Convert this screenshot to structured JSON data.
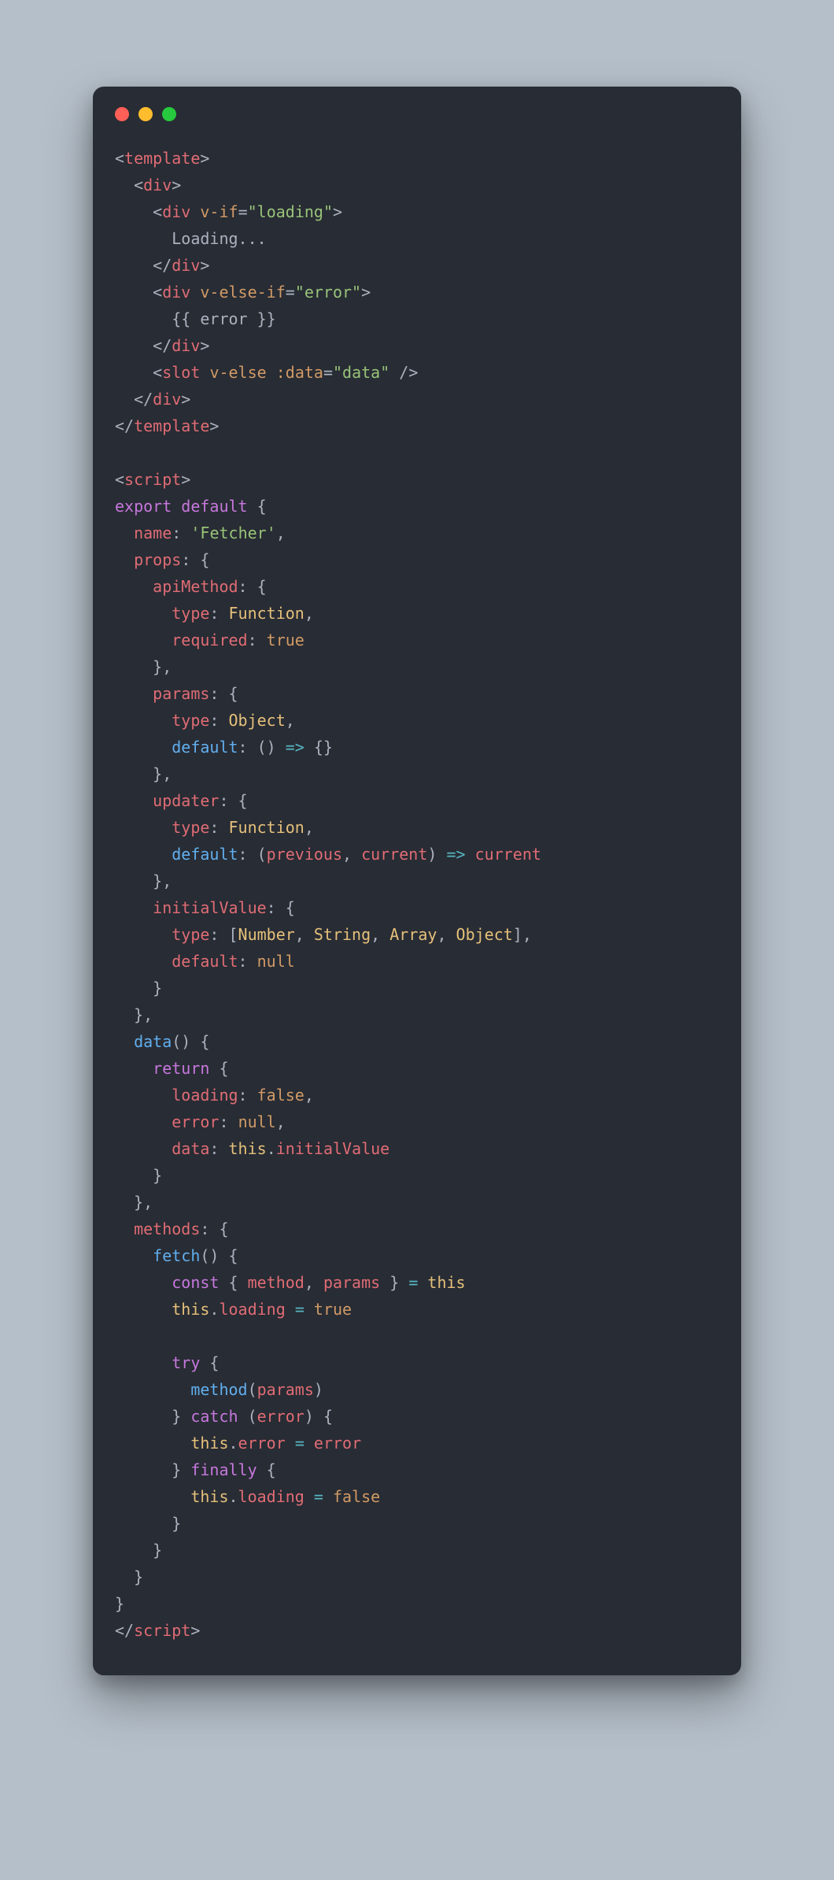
{
  "colors": {
    "bg_page": "#b5bfc9",
    "bg_window": "#282c34",
    "dot_red": "#ff5f56",
    "dot_yellow": "#ffbd2e",
    "dot_green": "#27c93f",
    "tag": "#e06c75",
    "attr": "#d19a66",
    "string": "#98c379",
    "keyword": "#c678dd",
    "function": "#61afef",
    "identifier": "#e5c07b",
    "operator": "#56b6c2",
    "plain": "#abb2bf"
  },
  "code_lines": [
    [
      [
        "plain",
        "<"
      ],
      [
        "tag",
        "template"
      ],
      [
        "plain",
        ">"
      ]
    ],
    [
      [
        "plain",
        "  <"
      ],
      [
        "tag",
        "div"
      ],
      [
        "plain",
        ">"
      ]
    ],
    [
      [
        "plain",
        "    <"
      ],
      [
        "tag",
        "div"
      ],
      [
        "plain",
        " "
      ],
      [
        "attr",
        "v-if"
      ],
      [
        "plain",
        "="
      ],
      [
        "str",
        "\"loading\""
      ],
      [
        "plain",
        ">"
      ]
    ],
    [
      [
        "plain",
        "      Loading..."
      ]
    ],
    [
      [
        "plain",
        "    </"
      ],
      [
        "tag",
        "div"
      ],
      [
        "plain",
        ">"
      ]
    ],
    [
      [
        "plain",
        "    <"
      ],
      [
        "tag",
        "div"
      ],
      [
        "plain",
        " "
      ],
      [
        "attr",
        "v-else-if"
      ],
      [
        "plain",
        "="
      ],
      [
        "str",
        "\"error\""
      ],
      [
        "plain",
        ">"
      ]
    ],
    [
      [
        "plain",
        "      {{ error }}"
      ]
    ],
    [
      [
        "plain",
        "    </"
      ],
      [
        "tag",
        "div"
      ],
      [
        "plain",
        ">"
      ]
    ],
    [
      [
        "plain",
        "    <"
      ],
      [
        "tag",
        "slot"
      ],
      [
        "plain",
        " "
      ],
      [
        "attr",
        "v-else"
      ],
      [
        "plain",
        " "
      ],
      [
        "attr",
        ":data"
      ],
      [
        "plain",
        "="
      ],
      [
        "str",
        "\"data\""
      ],
      [
        "plain",
        " />"
      ]
    ],
    [
      [
        "plain",
        "  </"
      ],
      [
        "tag",
        "div"
      ],
      [
        "plain",
        ">"
      ]
    ],
    [
      [
        "plain",
        "</"
      ],
      [
        "tag",
        "template"
      ],
      [
        "plain",
        ">"
      ]
    ],
    [
      [
        "plain",
        ""
      ]
    ],
    [
      [
        "plain",
        "<"
      ],
      [
        "tag",
        "script"
      ],
      [
        "plain",
        ">"
      ]
    ],
    [
      [
        "kw",
        "export"
      ],
      [
        "plain",
        " "
      ],
      [
        "kw",
        "default"
      ],
      [
        "plain",
        " {"
      ]
    ],
    [
      [
        "plain",
        "  "
      ],
      [
        "prop",
        "name"
      ],
      [
        "plain",
        ": "
      ],
      [
        "str",
        "'Fetcher'"
      ],
      [
        "plain",
        ","
      ]
    ],
    [
      [
        "plain",
        "  "
      ],
      [
        "prop",
        "props"
      ],
      [
        "plain",
        ": {"
      ]
    ],
    [
      [
        "plain",
        "    "
      ],
      [
        "prop",
        "apiMethod"
      ],
      [
        "plain",
        ": {"
      ]
    ],
    [
      [
        "plain",
        "      "
      ],
      [
        "prop",
        "type"
      ],
      [
        "plain",
        ": "
      ],
      [
        "id",
        "Function"
      ],
      [
        "plain",
        ","
      ]
    ],
    [
      [
        "plain",
        "      "
      ],
      [
        "prop",
        "required"
      ],
      [
        "plain",
        ": "
      ],
      [
        "attr",
        "true"
      ]
    ],
    [
      [
        "plain",
        "    },"
      ]
    ],
    [
      [
        "plain",
        "    "
      ],
      [
        "prop",
        "params"
      ],
      [
        "plain",
        ": {"
      ]
    ],
    [
      [
        "plain",
        "      "
      ],
      [
        "prop",
        "type"
      ],
      [
        "plain",
        ": "
      ],
      [
        "id",
        "Object"
      ],
      [
        "plain",
        ","
      ]
    ],
    [
      [
        "plain",
        "      "
      ],
      [
        "fn",
        "default"
      ],
      [
        "plain",
        ": () "
      ],
      [
        "op",
        "=>"
      ],
      [
        "plain",
        " {}"
      ]
    ],
    [
      [
        "plain",
        "    },"
      ]
    ],
    [
      [
        "plain",
        "    "
      ],
      [
        "prop",
        "updater"
      ],
      [
        "plain",
        ": {"
      ]
    ],
    [
      [
        "plain",
        "      "
      ],
      [
        "prop",
        "type"
      ],
      [
        "plain",
        ": "
      ],
      [
        "id",
        "Function"
      ],
      [
        "plain",
        ","
      ]
    ],
    [
      [
        "plain",
        "      "
      ],
      [
        "fn",
        "default"
      ],
      [
        "plain",
        ": ("
      ],
      [
        "prop",
        "previous"
      ],
      [
        "plain",
        ", "
      ],
      [
        "prop",
        "current"
      ],
      [
        "plain",
        ") "
      ],
      [
        "op",
        "=>"
      ],
      [
        "plain",
        " "
      ],
      [
        "prop",
        "current"
      ]
    ],
    [
      [
        "plain",
        "    },"
      ]
    ],
    [
      [
        "plain",
        "    "
      ],
      [
        "prop",
        "initialValue"
      ],
      [
        "plain",
        ": {"
      ]
    ],
    [
      [
        "plain",
        "      "
      ],
      [
        "prop",
        "type"
      ],
      [
        "plain",
        ": ["
      ],
      [
        "id",
        "Number"
      ],
      [
        "plain",
        ", "
      ],
      [
        "id",
        "String"
      ],
      [
        "plain",
        ", "
      ],
      [
        "id",
        "Array"
      ],
      [
        "plain",
        ", "
      ],
      [
        "id",
        "Object"
      ],
      [
        "plain",
        "],"
      ]
    ],
    [
      [
        "plain",
        "      "
      ],
      [
        "prop",
        "default"
      ],
      [
        "plain",
        ": "
      ],
      [
        "attr",
        "null"
      ]
    ],
    [
      [
        "plain",
        "    }"
      ]
    ],
    [
      [
        "plain",
        "  },"
      ]
    ],
    [
      [
        "plain",
        "  "
      ],
      [
        "fn",
        "data"
      ],
      [
        "plain",
        "() {"
      ]
    ],
    [
      [
        "plain",
        "    "
      ],
      [
        "kw",
        "return"
      ],
      [
        "plain",
        " {"
      ]
    ],
    [
      [
        "plain",
        "      "
      ],
      [
        "prop",
        "loading"
      ],
      [
        "plain",
        ": "
      ],
      [
        "attr",
        "false"
      ],
      [
        "plain",
        ","
      ]
    ],
    [
      [
        "plain",
        "      "
      ],
      [
        "prop",
        "error"
      ],
      [
        "plain",
        ": "
      ],
      [
        "attr",
        "null"
      ],
      [
        "plain",
        ","
      ]
    ],
    [
      [
        "plain",
        "      "
      ],
      [
        "prop",
        "data"
      ],
      [
        "plain",
        ": "
      ],
      [
        "this",
        "this"
      ],
      [
        "plain",
        "."
      ],
      [
        "prop",
        "initialValue"
      ]
    ],
    [
      [
        "plain",
        "    }"
      ]
    ],
    [
      [
        "plain",
        "  },"
      ]
    ],
    [
      [
        "plain",
        "  "
      ],
      [
        "prop",
        "methods"
      ],
      [
        "plain",
        ": {"
      ]
    ],
    [
      [
        "plain",
        "    "
      ],
      [
        "fn",
        "fetch"
      ],
      [
        "plain",
        "() {"
      ]
    ],
    [
      [
        "plain",
        "      "
      ],
      [
        "kw",
        "const"
      ],
      [
        "plain",
        " { "
      ],
      [
        "prop",
        "method"
      ],
      [
        "plain",
        ", "
      ],
      [
        "prop",
        "params"
      ],
      [
        "plain",
        " } "
      ],
      [
        "op",
        "="
      ],
      [
        "plain",
        " "
      ],
      [
        "this",
        "this"
      ]
    ],
    [
      [
        "plain",
        "      "
      ],
      [
        "this",
        "this"
      ],
      [
        "plain",
        "."
      ],
      [
        "prop",
        "loading"
      ],
      [
        "plain",
        " "
      ],
      [
        "op",
        "="
      ],
      [
        "plain",
        " "
      ],
      [
        "attr",
        "true"
      ]
    ],
    [
      [
        "plain",
        ""
      ]
    ],
    [
      [
        "plain",
        "      "
      ],
      [
        "kw",
        "try"
      ],
      [
        "plain",
        " {"
      ]
    ],
    [
      [
        "plain",
        "        "
      ],
      [
        "fn",
        "method"
      ],
      [
        "plain",
        "("
      ],
      [
        "prop",
        "params"
      ],
      [
        "plain",
        ")"
      ]
    ],
    [
      [
        "plain",
        "      } "
      ],
      [
        "kw",
        "catch"
      ],
      [
        "plain",
        " ("
      ],
      [
        "prop",
        "error"
      ],
      [
        "plain",
        ") {"
      ]
    ],
    [
      [
        "plain",
        "        "
      ],
      [
        "this",
        "this"
      ],
      [
        "plain",
        "."
      ],
      [
        "prop",
        "error"
      ],
      [
        "plain",
        " "
      ],
      [
        "op",
        "="
      ],
      [
        "plain",
        " "
      ],
      [
        "prop",
        "error"
      ]
    ],
    [
      [
        "plain",
        "      } "
      ],
      [
        "kw",
        "finally"
      ],
      [
        "plain",
        " {"
      ]
    ],
    [
      [
        "plain",
        "        "
      ],
      [
        "this",
        "this"
      ],
      [
        "plain",
        "."
      ],
      [
        "prop",
        "loading"
      ],
      [
        "plain",
        " "
      ],
      [
        "op",
        "="
      ],
      [
        "plain",
        " "
      ],
      [
        "attr",
        "false"
      ]
    ],
    [
      [
        "plain",
        "      }"
      ]
    ],
    [
      [
        "plain",
        "    }"
      ]
    ],
    [
      [
        "plain",
        "  }"
      ]
    ],
    [
      [
        "plain",
        "}"
      ]
    ],
    [
      [
        "plain",
        "</"
      ],
      [
        "tag",
        "script"
      ],
      [
        "plain",
        ">"
      ]
    ]
  ]
}
